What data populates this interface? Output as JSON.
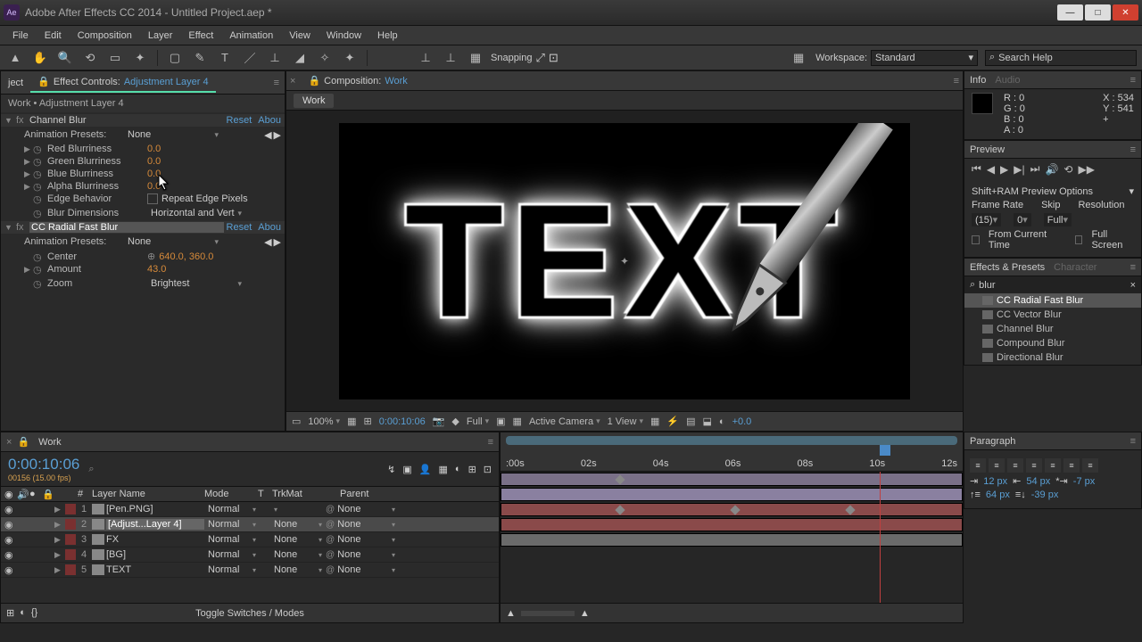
{
  "titlebar": {
    "app": "Adobe After Effects CC 2014 - Untitled Project.aep *"
  },
  "menu": [
    "File",
    "Edit",
    "Composition",
    "Layer",
    "Effect",
    "Animation",
    "View",
    "Window",
    "Help"
  ],
  "toolbar": {
    "snapping": "Snapping",
    "workspace_lbl": "Workspace:",
    "workspace": "Standard",
    "search_ph": "Search Help"
  },
  "ec": {
    "tab_project": "ject",
    "tab_fx": "Effect Controls:",
    "tab_fx_layer": "Adjustment Layer 4",
    "crumb": "Work • Adjustment Layer 4",
    "fx1": {
      "name": "Channel Blur",
      "reset": "Reset",
      "about": "Abou",
      "presets_lbl": "Animation Presets:",
      "presets": "None",
      "red": "Red Blurriness",
      "red_v": "0.0",
      "green": "Green Blurriness",
      "green_v": "0.0",
      "blue": "Blue Blurriness",
      "blue_v": "0.0",
      "alpha": "Alpha Blurriness",
      "alpha_v": "0.0",
      "edge": "Edge Behavior",
      "edge_v": "Repeat Edge Pixels",
      "dim": "Blur Dimensions",
      "dim_v": "Horizontal and Vert"
    },
    "fx2": {
      "name": "CC Radial Fast Blur",
      "reset": "Reset",
      "about": "Abou",
      "presets_lbl": "Animation Presets:",
      "presets": "None",
      "center": "Center",
      "center_v": "640.0, 360.0",
      "amount": "Amount",
      "amount_v": "43.0",
      "zoom": "Zoom",
      "zoom_v": "Brightest"
    }
  },
  "comp": {
    "tab": "Composition:",
    "tab_link": "Work",
    "subtab": "Work",
    "text": "TEXT",
    "zoom": "100%",
    "tc": "0:00:10:06",
    "full": "Full",
    "camera": "Active Camera",
    "view": "1 View",
    "crop": "+0.0"
  },
  "info": {
    "r": "R : 0",
    "g": "G : 0",
    "b": "B : 0",
    "a": "A : 0",
    "x": "X : 534",
    "y": "Y : 541",
    "plus": "+"
  },
  "preview": {
    "title": "Preview",
    "opts_title": "Shift+RAM Preview Options",
    "fr_lbl": "Frame Rate",
    "fr": "(15)",
    "skip_lbl": "Skip",
    "skip": "0",
    "res_lbl": "Resolution",
    "res": "Full",
    "from": "From Current Time",
    "fs": "Full Screen"
  },
  "ep": {
    "title": "Effects & Presets",
    "char": "Character",
    "query": "blur",
    "items": [
      "CC Radial Fast Blur",
      "CC Vector Blur",
      "Channel Blur",
      "Compound Blur",
      "Directional Blur"
    ]
  },
  "tl": {
    "tab": "Work",
    "time": "0:00:10:06",
    "sub": "00156 (15.00 fps)",
    "hdr": {
      "layer": "Layer Name",
      "mode": "Mode",
      "trk": "TrkMat",
      "parent": "Parent"
    },
    "layers": [
      {
        "n": "1",
        "name": "[Pen.PNG]",
        "mode": "Normal",
        "trk": "",
        "par": "None",
        "clr": "#7a3030"
      },
      {
        "n": "2",
        "name": "[Adjust...Layer 4]",
        "mode": "Normal",
        "trk": "None",
        "par": "None",
        "clr": "#7a3030",
        "sel": true
      },
      {
        "n": "3",
        "name": "FX",
        "mode": "Normal",
        "trk": "None",
        "par": "None",
        "clr": "#7a3030"
      },
      {
        "n": "4",
        "name": "[BG]",
        "mode": "Normal",
        "trk": "None",
        "par": "None",
        "clr": "#7a3030"
      },
      {
        "n": "5",
        "name": "TEXT",
        "mode": "Normal",
        "trk": "None",
        "par": "None",
        "clr": "#7a3030"
      }
    ],
    "ticks": [
      ":00s",
      "02s",
      "04s",
      "06s",
      "08s",
      "10s",
      "12s"
    ],
    "toggle": "Toggle Switches / Modes"
  },
  "para": {
    "title": "Paragraph",
    "il": "12 px",
    "ir": "54 px",
    "ifl": "-7 px",
    "sb": "64 px",
    "sa": "-39 px"
  },
  "tabs": {
    "info": "Info",
    "audio": "Audio"
  }
}
